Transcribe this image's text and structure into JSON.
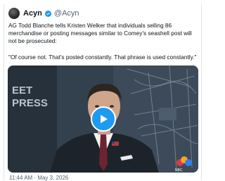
{
  "tweet": {
    "author_name": "Acyn",
    "author_handle": "@Acyn",
    "body": "AG Todd Blanche tells Kristen Welker that individuals selling 86 merchandise or posting messages similar to Comey's seashell post will not be prosecuted:\n\n\"Of course not. That's posted constantly. That phrase is used constantly.\"",
    "timestamp": "11:44 AM · May 3, 2026"
  },
  "video": {
    "set_text": "EET PRESS",
    "network_logo_text": "NBC"
  },
  "icons": {
    "verified": "verified-badge-icon",
    "play": "play-icon",
    "avatar": "avatar"
  },
  "colors": {
    "accent": "#1d9bf0",
    "text": "#0f1419",
    "secondary": "#536471"
  }
}
